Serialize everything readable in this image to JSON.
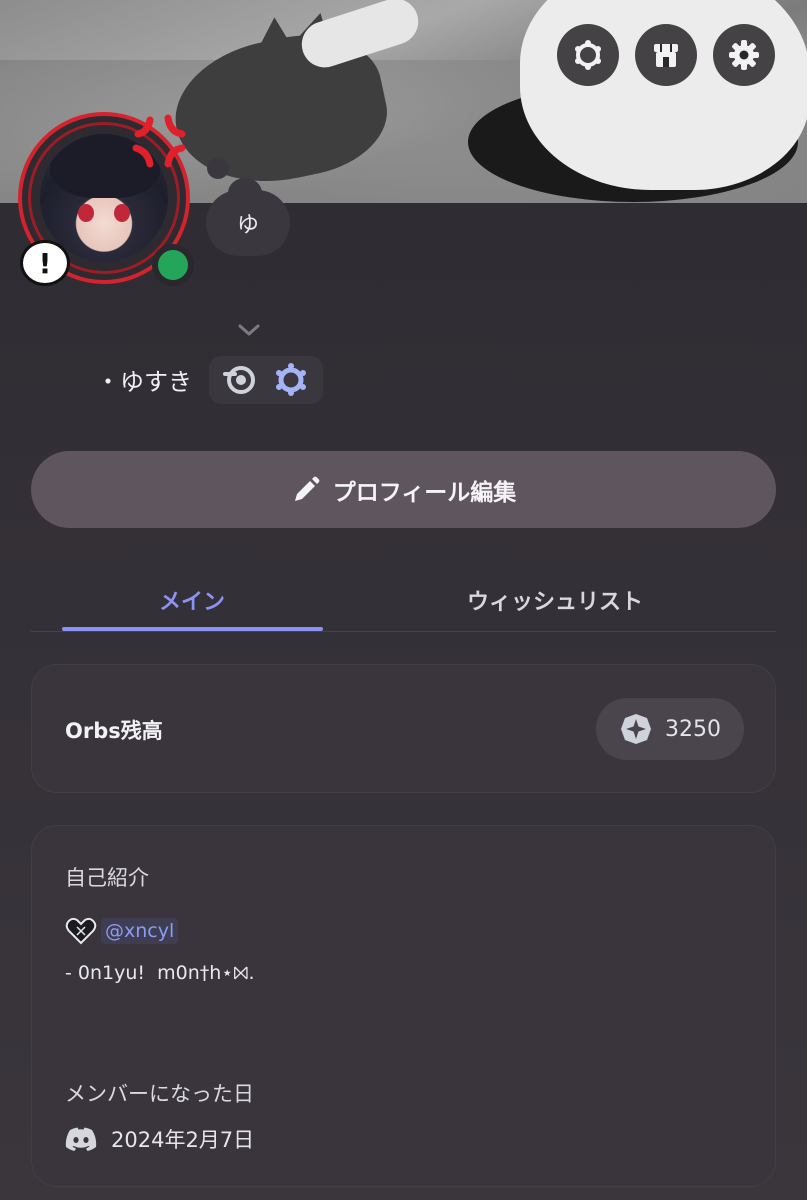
{
  "header": {
    "icons": [
      "nitro-ring-icon",
      "shop-icon",
      "gear-icon"
    ]
  },
  "avatar": {
    "status": "online",
    "status_color": "#23a55a",
    "decoration_color": "#d4232c",
    "alert_glyph": "!"
  },
  "status_bubble": {
    "text": "ゆ"
  },
  "profile": {
    "display_name": "・ゆすき",
    "badges": [
      "orb-quest-badge",
      "nitro-badge"
    ]
  },
  "actions": {
    "edit_profile_label": "プロフィール編集"
  },
  "tabs": [
    {
      "label": "メイン",
      "active": true
    },
    {
      "label": "ウィッシュリスト",
      "active": false
    }
  ],
  "orbs": {
    "label": "Orbs残高",
    "balance": "3250"
  },
  "bio": {
    "title": "自己紹介",
    "mention": "@xncyl",
    "line2": "- 0n1yu!  m0n†h⋆⨝."
  },
  "member_since": {
    "title": "メンバーになった日",
    "date": "2024年2月7日"
  },
  "colors": {
    "accent": "#8b93f5",
    "background": "#2c2930",
    "card": "#3a353d",
    "button": "#5e555e"
  }
}
